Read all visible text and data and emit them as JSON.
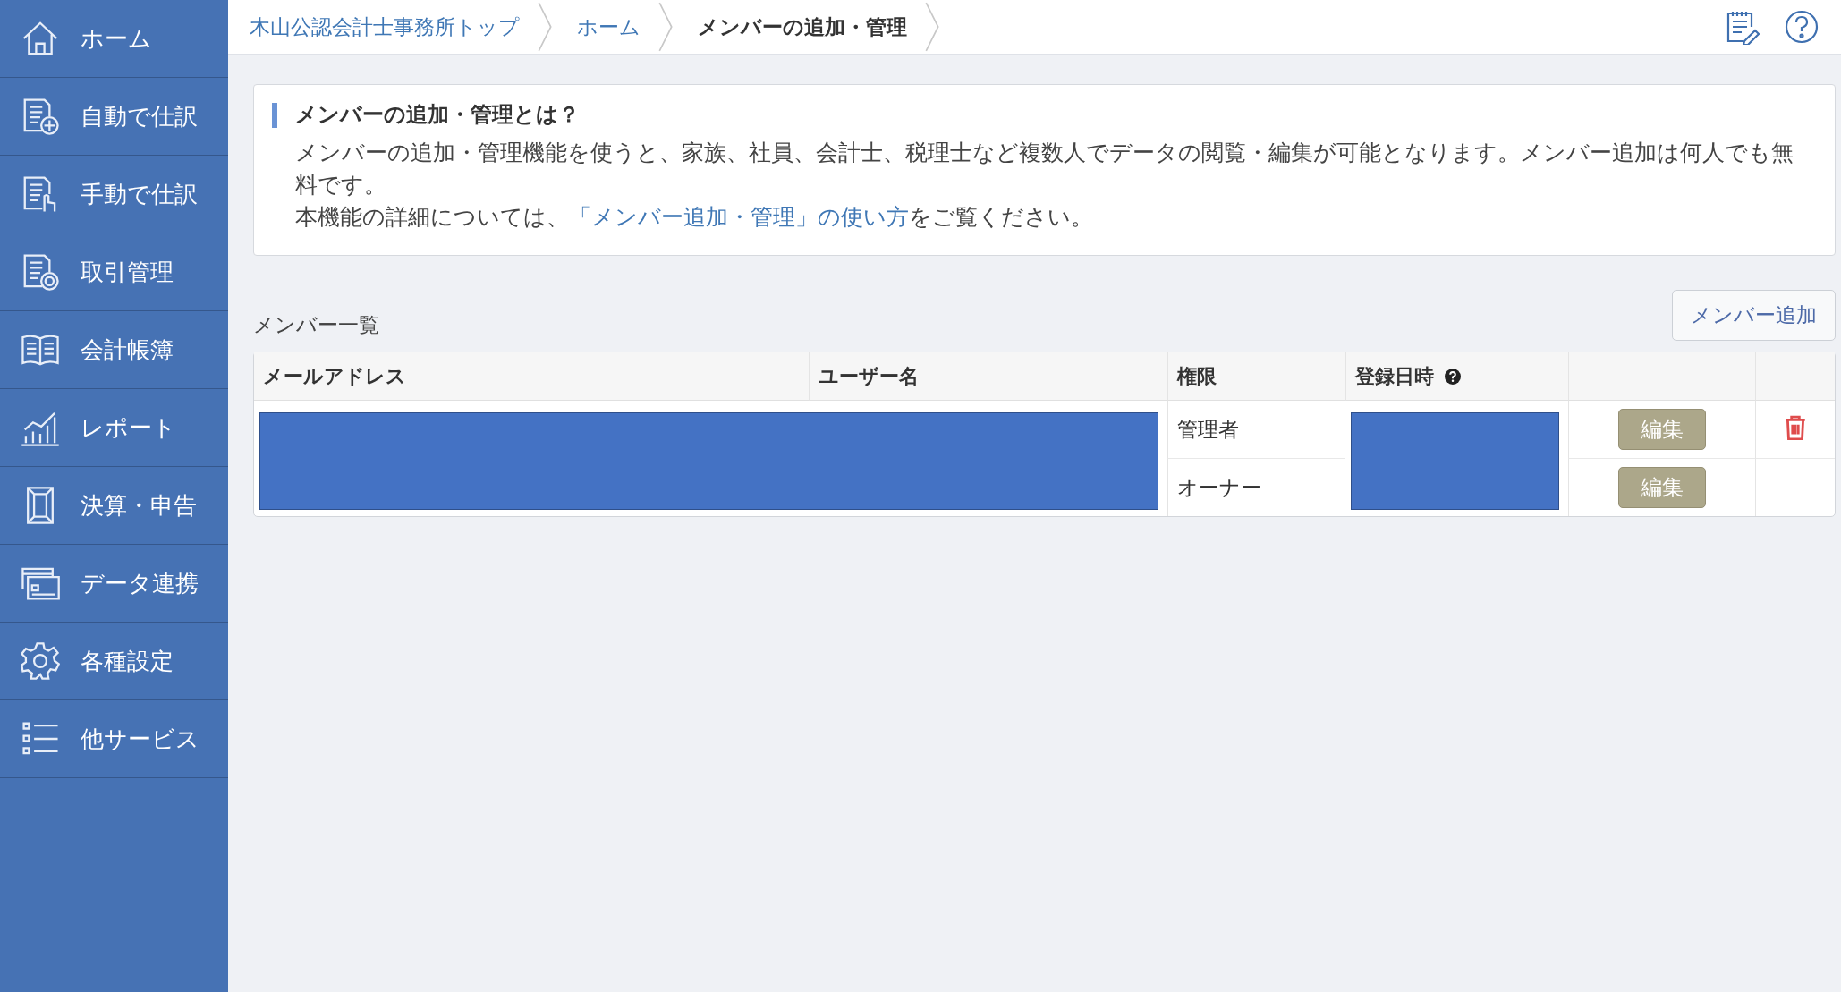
{
  "sidebar": {
    "items": [
      {
        "label": "ホーム",
        "kind": "home"
      },
      {
        "label": "自動で仕訳",
        "kind": "auto"
      },
      {
        "label": "手動で仕訳",
        "kind": "manual"
      },
      {
        "label": "取引管理",
        "kind": "deals"
      },
      {
        "label": "会計帳簿",
        "kind": "books"
      },
      {
        "label": "レポート",
        "kind": "report"
      },
      {
        "label": "決算・申告",
        "kind": "closing"
      },
      {
        "label": "データ連携",
        "kind": "cards"
      },
      {
        "label": "各種設定",
        "kind": "settings"
      },
      {
        "label": "他サービス",
        "kind": "list"
      }
    ]
  },
  "breadcrumb": [
    {
      "label": "木山公認会計士事務所トップ",
      "current": false
    },
    {
      "label": "ホーム",
      "current": false
    },
    {
      "label": "メンバーの追加・管理",
      "current": true
    }
  ],
  "info": {
    "title": "メンバーの追加・管理とは？",
    "body": "メンバーの追加・管理機能を使うと、家族、社員、会計士、税理士など複数人でデータの閲覧・編集が可能となります。メンバー追加は何人でも無料です。",
    "detail_before": "本機能の詳細については、",
    "link": "「メンバー追加・管理」の使い方",
    "detail_after": "をご覧ください。"
  },
  "members": {
    "title": "メンバー一覧",
    "add_button": "メンバー追加",
    "columns": [
      "メールアドレス",
      "ユーザー名",
      "権限",
      "登録日時"
    ],
    "rows": [
      {
        "role": "管理者",
        "edit": "編集",
        "deletable": true
      },
      {
        "role": "オーナー",
        "edit": "編集",
        "deletable": false
      }
    ]
  }
}
